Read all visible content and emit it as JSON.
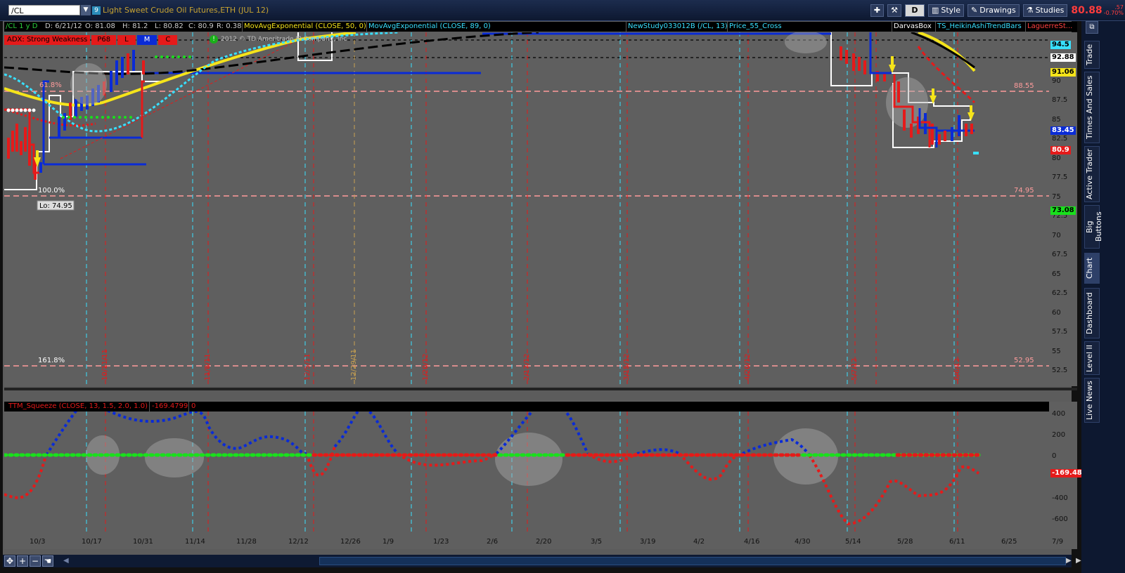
{
  "toolbar": {
    "symbol": "/CL",
    "link_badge": "9",
    "instrument": "Light Sweet Crude Oil Futures,ETH (JUL 12)",
    "period_btn": "D",
    "style_label": "Style",
    "drawings_label": "Drawings",
    "studies_label": "Studies",
    "last_price": "80.88",
    "change_up": ".57",
    "change_pct": "-0.70%"
  },
  "infobar": {
    "symbol_period": "/CL 1 y D",
    "date": "D: 6/21/12",
    "open": "O: 81.08",
    "high": "H: 81.2",
    "low": "L: 80.82",
    "close": "C: 80.9",
    "range": "R: 0.38",
    "study1": "MovAvgExponential (CLOSE, 50, 0)",
    "study2": "MovAvgExponential (CLOSE, 89, 0)",
    "study3": "NewStudy033012B (/CL, 13)",
    "study4": "Price_55_Cross",
    "study5": "DarvasBox",
    "study6": "TS_HeikinAshiTrendBars",
    "study7": "LaguerreSt..."
  },
  "adx": {
    "label": "ADX: Strong Weakness",
    "p": "P68",
    "l": "L",
    "m": "M",
    "c": "C"
  },
  "copyright": "2012 © TD Ameritrade IP Company, Inc",
  "fib": {
    "f618": "61.8%",
    "f100": "100.0%",
    "f1618": "161.8%",
    "lo": "Lo: 74.95",
    "lvl_8855": "88.55",
    "lvl_7495": "74.95",
    "lvl_5295": "52.95"
  },
  "price_axis": {
    "ticks": [
      "90",
      "87.5",
      "85",
      "82.5",
      "80",
      "77.5",
      "75",
      "72.5",
      "70",
      "67.5",
      "65",
      "62.5",
      "60",
      "57.5",
      "55",
      "52.5"
    ],
    "tag_945": "94.5",
    "tag_9288": "92.88",
    "tag_9106": "91.06",
    "tag_8345": "83.45",
    "tag_809": "80.9",
    "tag_7308": "73.08"
  },
  "lower": {
    "title": "TTM_Squeeze (CLOSE, 13, 1.5, 2.0, 1.0)",
    "value": "-169.4799",
    "zero": "0",
    "ticks": [
      "400",
      "200",
      "0",
      "-400",
      "-600"
    ],
    "tag": "-169.48"
  },
  "x_axis": [
    "10/3",
    "10/17",
    "10/31",
    "11/14",
    "11/28",
    "12/12",
    "12/26",
    "1/9",
    "1/23",
    "2/6",
    "2/20",
    "3/5",
    "3/19",
    "4/2",
    "4/16",
    "4/30",
    "5/14",
    "5/28",
    "6/11",
    "6/25",
    "7/9"
  ],
  "vertical_labels": [
    "10/11/11",
    "11/8/11",
    "12/5/11",
    "12/29/11",
    "1/20/12",
    "2/17/12",
    "3/15/12",
    "4/20/12",
    "5/7/12",
    "6/6/12"
  ],
  "side_tabs": [
    "Trade",
    "Times And Sales",
    "Active Trader",
    "Big Buttons",
    "Chart",
    "Dashboard",
    "Level II",
    "Live News"
  ],
  "colors": {
    "up": "#0a2bd6",
    "down": "#e51a1a",
    "ema50": "#f5e41a",
    "ema89": "#000000",
    "cyan": "#38e0ff",
    "white_box": "#ffffff",
    "green_dot": "#19e01c"
  }
}
